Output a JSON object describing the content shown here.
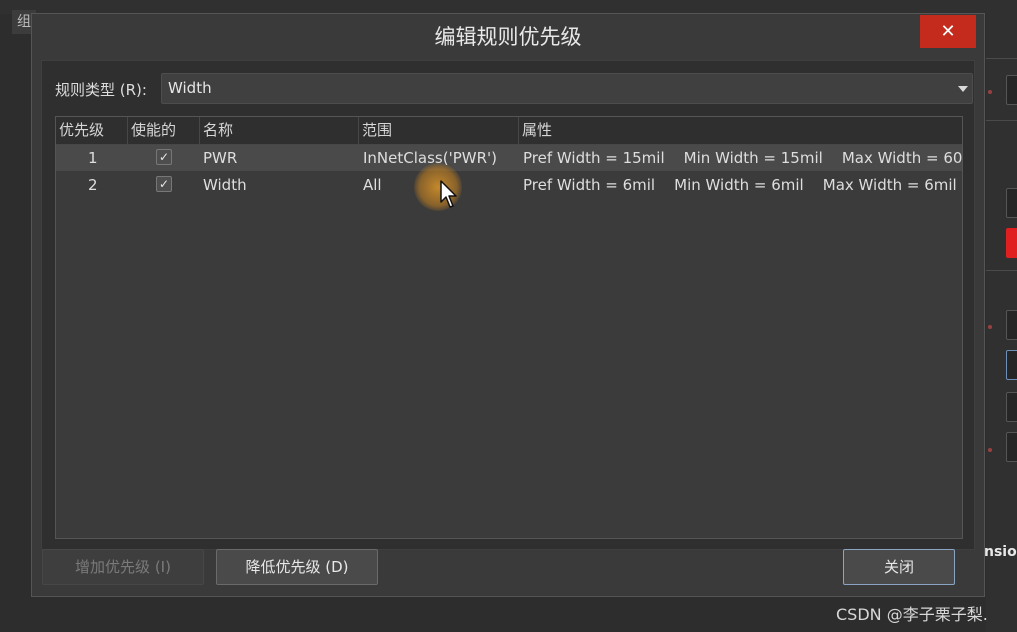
{
  "background": {
    "left_tab_glyph": "组",
    "edge_text": "nsio"
  },
  "dialog": {
    "title": "编辑规则优先级",
    "close_glyph": "✕",
    "rule_type": {
      "label": "规则类型 (R):",
      "selected": "Width"
    },
    "grid": {
      "columns": [
        "优先级",
        "使能的",
        "名称",
        "范围",
        "属性"
      ],
      "rows": [
        {
          "priority": "1",
          "enabled": true,
          "name": "PWR",
          "scope": "InNetClass('PWR')",
          "attributes": "Pref Width = 15mil    Min Width = 15mil    Max Width = 60",
          "selected": true
        },
        {
          "priority": "2",
          "enabled": true,
          "name": "Width",
          "scope": "All",
          "attributes": "Pref Width = 6mil    Min Width = 6mil    Max Width = 6mil",
          "selected": false
        }
      ]
    },
    "buttons": {
      "increase_priority": "增加优先级 (I)",
      "decrease_priority": "降低优先级 (D)",
      "close": "关闭"
    }
  },
  "watermark": "CSDN @李子栗子梨.",
  "colors": {
    "close_button": "#c42b1c",
    "dialog_bg": "#3a3a3a",
    "grid_bg": "#3b3b3b",
    "selected_row": "#4a4a4a"
  },
  "icons": {
    "dropdown": "chevron-down-icon",
    "close": "close-icon",
    "checkbox": "check-icon",
    "cursor": "mouse-pointer-icon"
  }
}
